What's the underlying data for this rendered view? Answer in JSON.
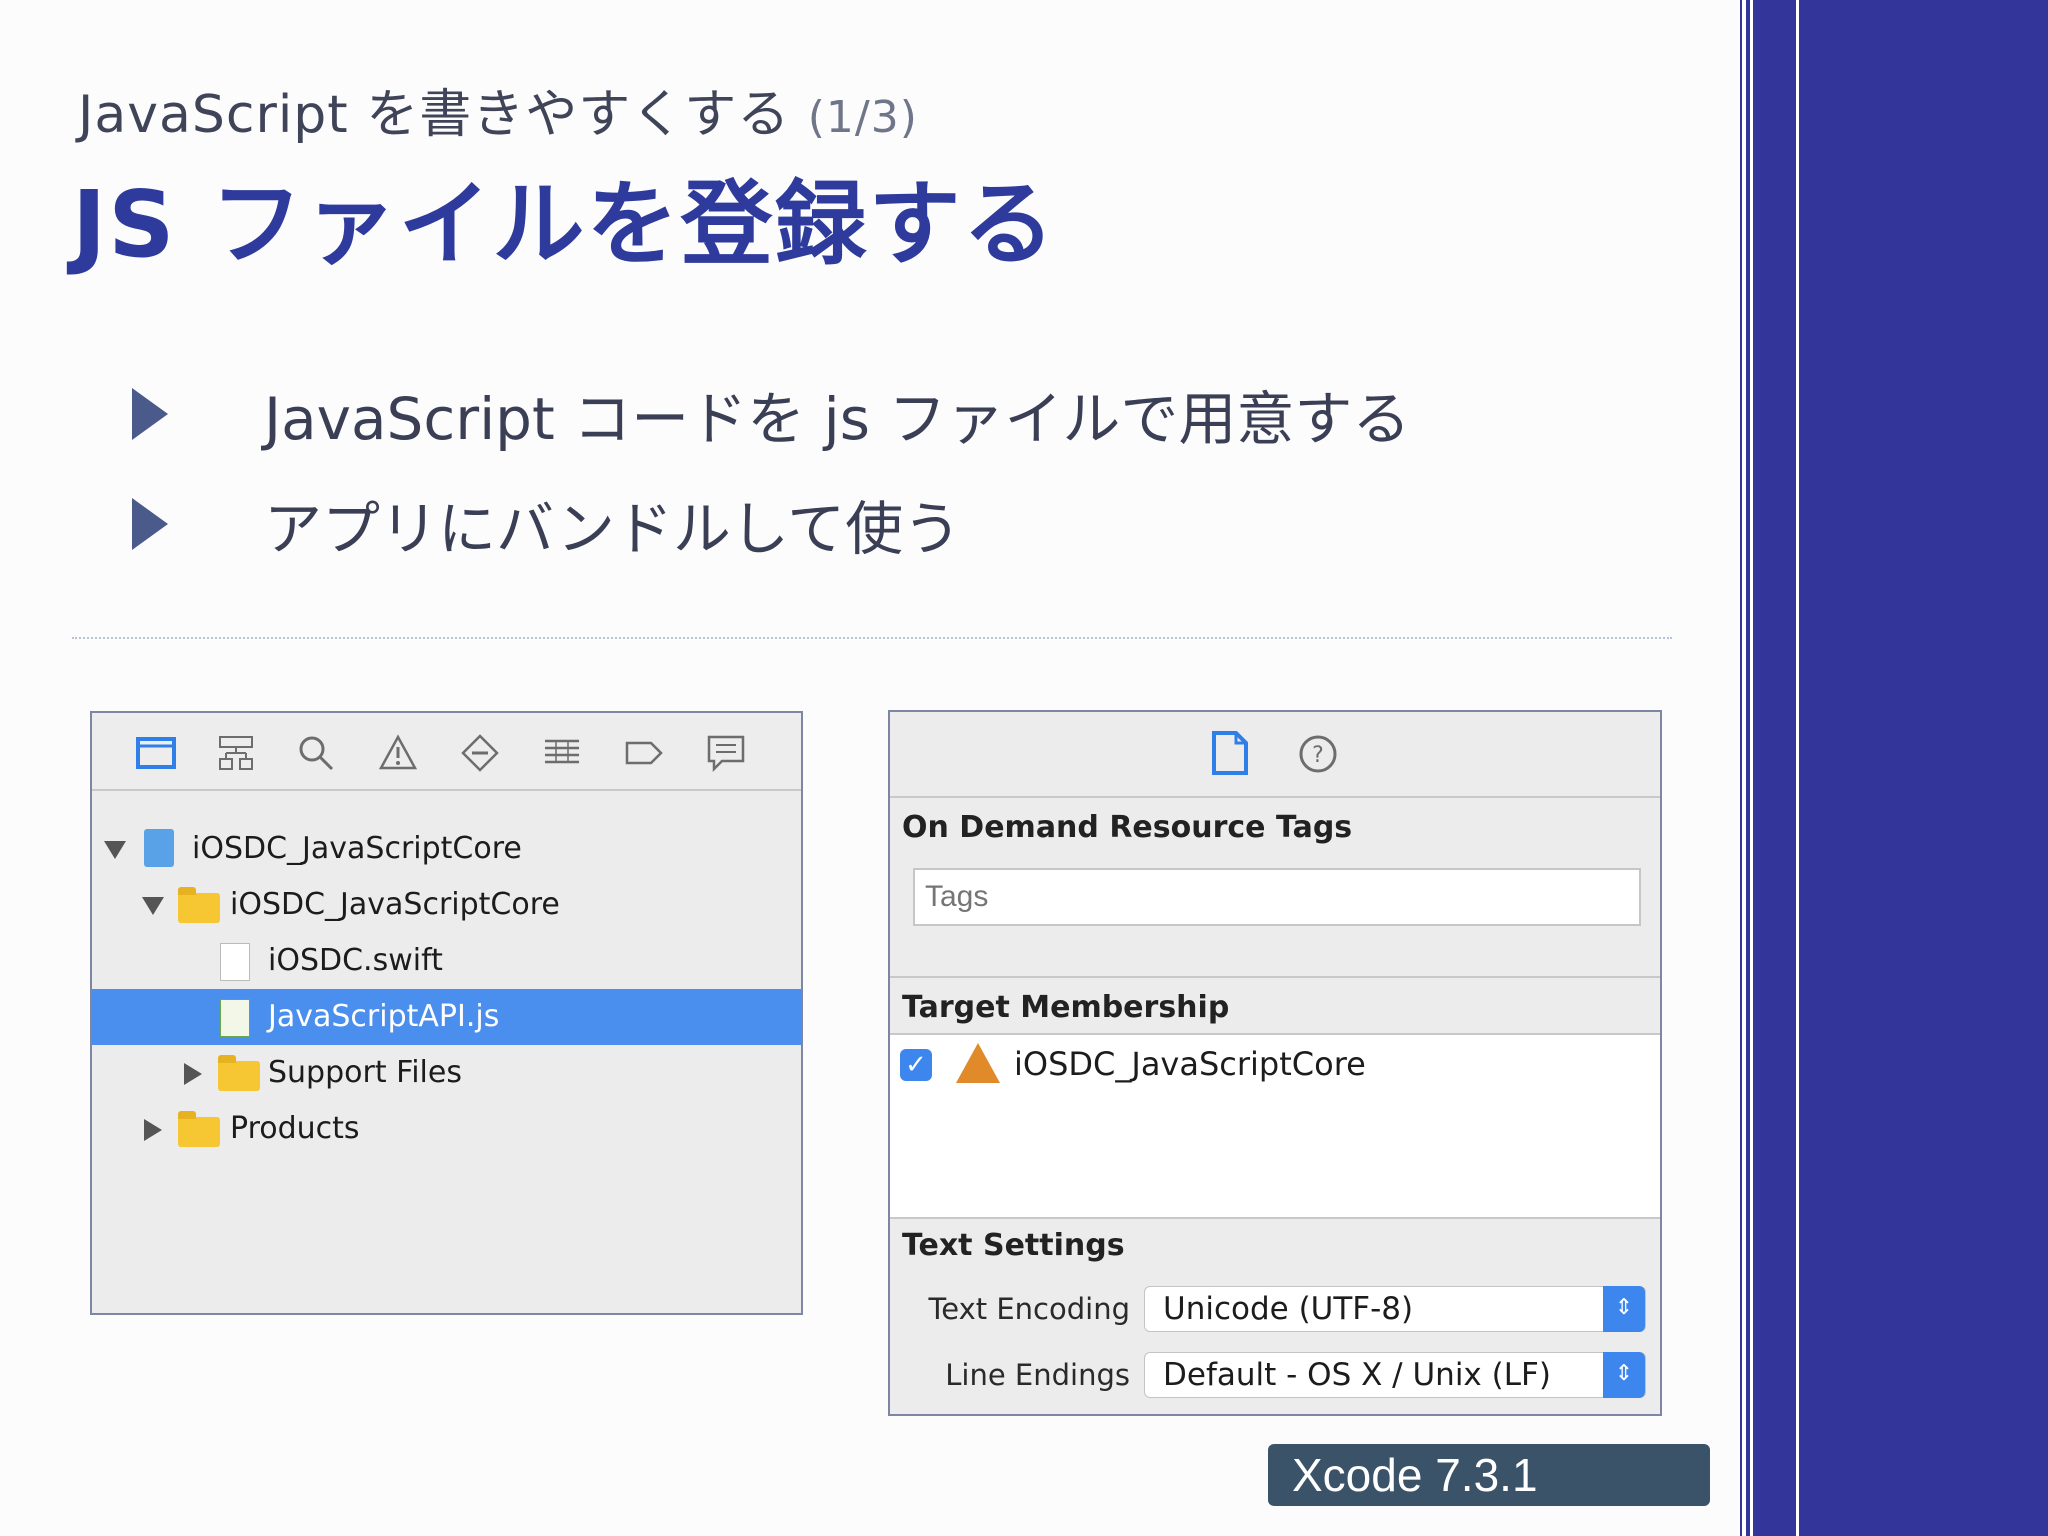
{
  "slide": {
    "subtitle": "JavaScript を書きやすくする",
    "subtitle_page": "(1/3)",
    "title": "JS ファイルを登録する",
    "bullets": [
      "JavaScript コードを js ファイルで用意する",
      "アプリにバンドルして使う"
    ],
    "badge": "Xcode 7.3.1",
    "colors": {
      "title": "#2e3b9c",
      "band": "#33359b",
      "selection": "#4a8eee",
      "badge": "#3b5369"
    }
  },
  "navigator": {
    "toolbar_icons": [
      "folder-icon",
      "hierarchy-icon",
      "search-icon",
      "warning-icon",
      "diamond-icon",
      "list-icon",
      "tag-icon",
      "message-icon"
    ],
    "items": [
      {
        "label": "iOSDC_JavaScriptCore",
        "kind": "project",
        "expanded": true
      },
      {
        "label": "iOSDC_JavaScriptCore",
        "kind": "folder",
        "expanded": true
      },
      {
        "label": "iOSDC.swift",
        "kind": "swift-file"
      },
      {
        "label": "JavaScriptAPI.js",
        "kind": "js-file",
        "selected": true
      },
      {
        "label": "Support Files",
        "kind": "folder",
        "expanded": false
      },
      {
        "label": "Products",
        "kind": "folder",
        "expanded": false
      }
    ]
  },
  "inspector": {
    "toolbar_icons": [
      "file-icon",
      "help-icon"
    ],
    "on_demand_title": "On Demand Resource Tags",
    "tags_placeholder": "Tags",
    "target_membership_title": "Target Membership",
    "target": {
      "label": "iOSDC_JavaScriptCore",
      "checked": true
    },
    "text_settings_title": "Text Settings",
    "text_encoding_label": "Text Encoding",
    "text_encoding_value": "Unicode (UTF-8)",
    "line_endings_label": "Line Endings",
    "line_endings_value": "Default - OS X / Unix (LF)"
  }
}
